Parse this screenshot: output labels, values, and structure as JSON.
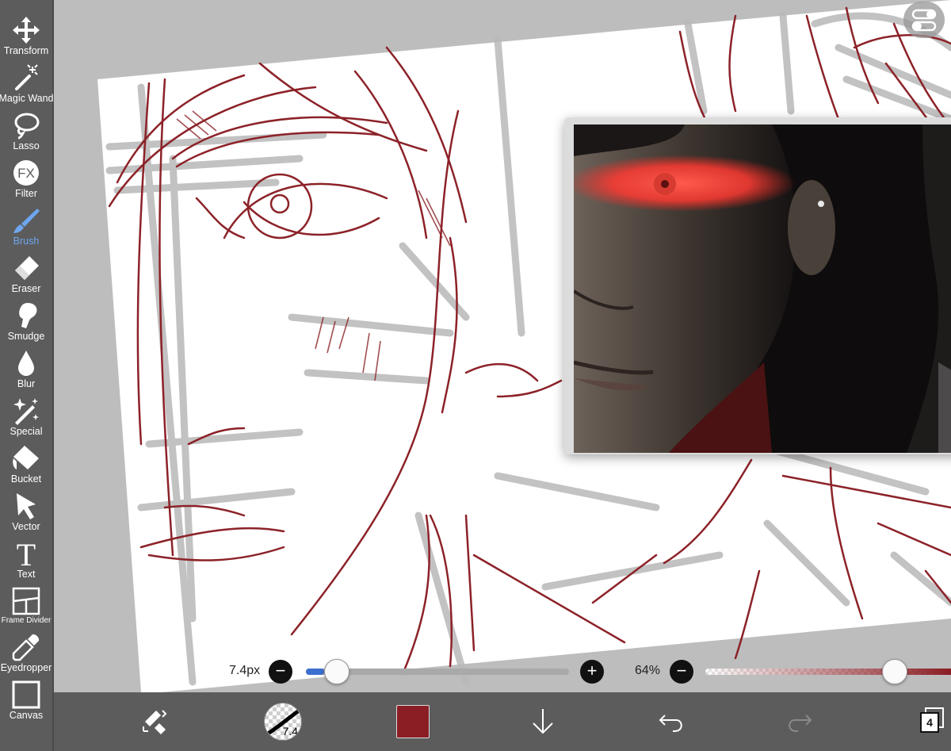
{
  "toolbar": {
    "tools": [
      {
        "label": "Transform",
        "icon": "move-arrows-icon"
      },
      {
        "label": "Magic Wand",
        "icon": "magic-wand-icon"
      },
      {
        "label": "Lasso",
        "icon": "lasso-icon"
      },
      {
        "label": "Filter",
        "icon": "fx-icon",
        "glyph": "FX"
      },
      {
        "label": "Brush",
        "icon": "brush-icon",
        "active": true
      },
      {
        "label": "Eraser",
        "icon": "eraser-icon"
      },
      {
        "label": "Smudge",
        "icon": "smudge-icon"
      },
      {
        "label": "Blur",
        "icon": "blur-drop-icon"
      },
      {
        "label": "Special",
        "icon": "sparkle-wand-icon"
      },
      {
        "label": "Bucket",
        "icon": "bucket-icon"
      },
      {
        "label": "Vector",
        "icon": "vector-arrow-icon"
      },
      {
        "label": "Text",
        "icon": "text-icon",
        "glyph": "T"
      },
      {
        "label": "Frame Divider",
        "icon": "frame-divider-icon"
      },
      {
        "label": "Eyedropper",
        "icon": "eyedropper-icon"
      },
      {
        "label": "Canvas",
        "icon": "canvas-icon"
      }
    ],
    "active_color": "#6ea6f0"
  },
  "sliders": {
    "brush_size": {
      "text": "7.4px",
      "minus": "−",
      "plus": "+",
      "fraction": 0.07
    },
    "opacity": {
      "text": "64%",
      "minus": "−",
      "fraction": 0.72
    }
  },
  "bottombar": {
    "brush_badge": "7.4",
    "primary_color": "#8a1e24",
    "layers_count": "4"
  },
  "colors": {
    "toolbar_bg": "#5c5c5c",
    "sketch_red": "#8c2228",
    "sketch_gray": "#b5b5b5"
  }
}
